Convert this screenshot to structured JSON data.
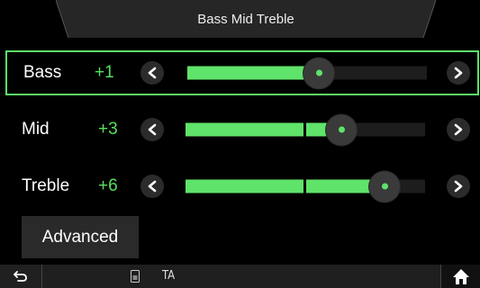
{
  "header": {
    "title": "Bass Mid Treble"
  },
  "rows": [
    {
      "label": "Bass",
      "value": "+1",
      "level": 0.55
    },
    {
      "label": "Mid",
      "value": "+3",
      "level": 0.65
    },
    {
      "label": "Treble",
      "value": "+6",
      "level": 0.83
    }
  ],
  "advanced": {
    "label": "Advanced"
  },
  "bottom_bar": {
    "ta_label": "TA"
  },
  "colors": {
    "accent": "#5fe36a",
    "background": "#000000",
    "button": "#2a2a2a"
  },
  "icons": {
    "back": "back-arrow-icon",
    "sd": "sd-card-icon",
    "home": "home-icon",
    "left": "chevron-left-icon",
    "right": "chevron-right-icon"
  }
}
